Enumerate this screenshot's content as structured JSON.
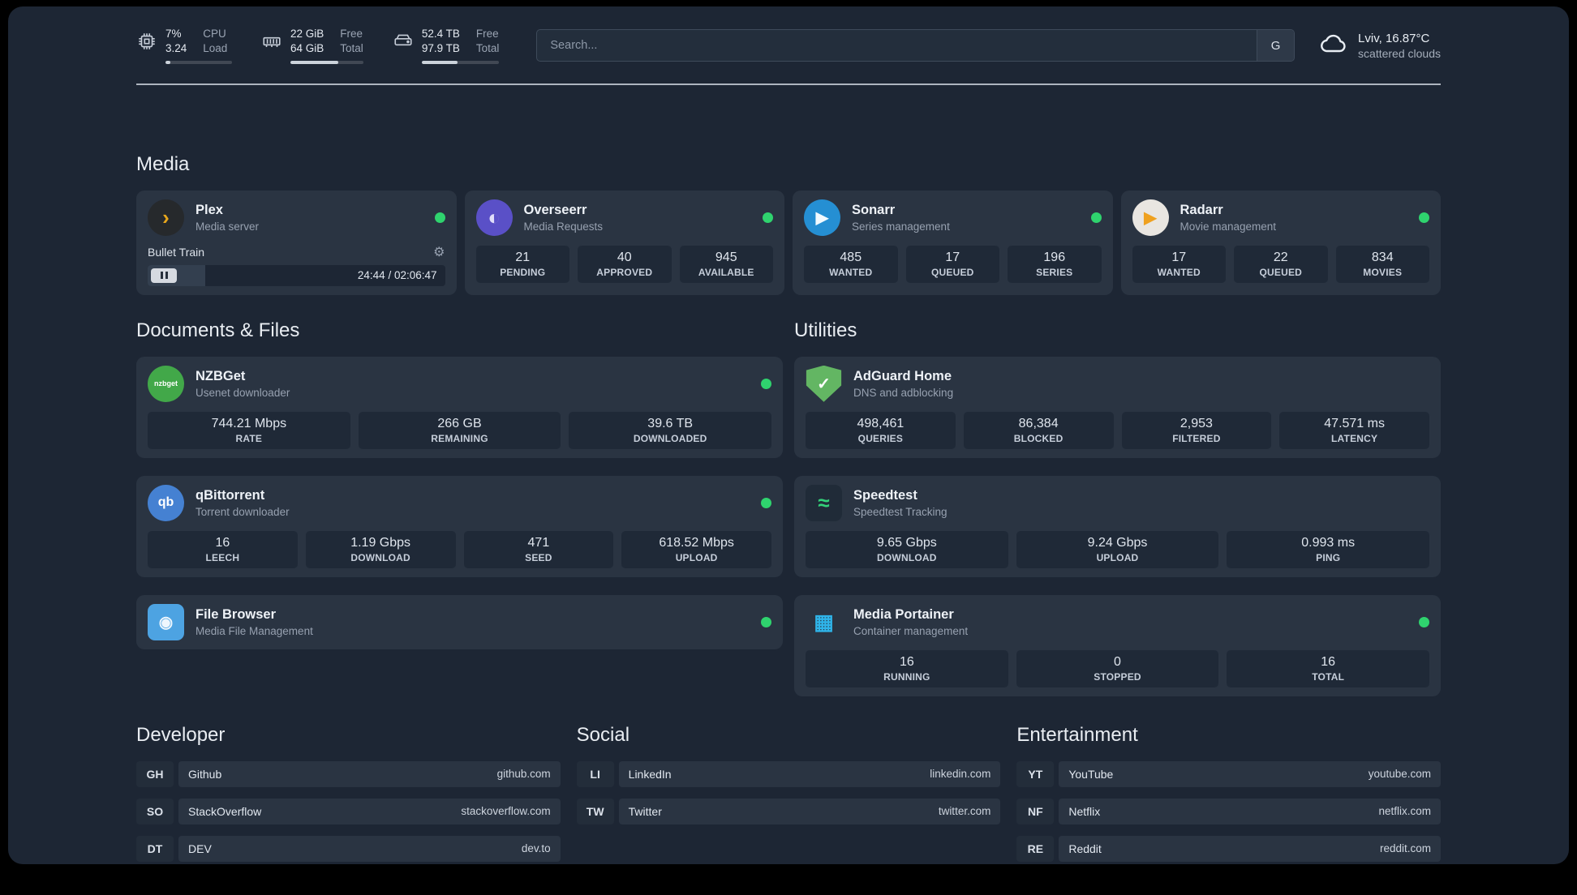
{
  "colors": {
    "status_online": "#2fd36e",
    "page_background": "#1d2634",
    "card_background": "#2a3442"
  },
  "icons": {
    "gear": "⚙"
  },
  "topbar": {
    "cpu": {
      "value": "7%",
      "load": "3.24",
      "label_top": "CPU",
      "label_bottom": "Load",
      "bar_percent": 7
    },
    "memory": {
      "free": "22 GiB",
      "total": "64 GiB",
      "label_top": "Free",
      "label_bottom": "Total",
      "bar_percent": 66
    },
    "storage": {
      "free": "52.4 TB",
      "total": "97.9 TB",
      "label_top": "Free",
      "label_bottom": "Total",
      "bar_percent": 46
    },
    "search": {
      "placeholder": "Search...",
      "button_label": "G"
    },
    "weather": {
      "location": "Lviv, 16.87°C",
      "condition": "scattered clouds"
    }
  },
  "sections": {
    "media": {
      "title": "Media",
      "cards": [
        {
          "name": "Plex",
          "subtitle": "Media server",
          "online": true,
          "icon": {
            "glyph": "›",
            "bg": "#26292c",
            "fg": "#e8a71c",
            "cls": "bigglyph"
          },
          "widget": {
            "title": "Bullet Train",
            "time": "24:44 / 02:06:47",
            "percent": 19.5
          },
          "stats": []
        },
        {
          "name": "Overseerr",
          "subtitle": "Media Requests",
          "online": true,
          "icon": {
            "glyph": "◐",
            "bg": "#5a50c7",
            "fg": "#e0defa",
            "cls": "bigglyph"
          },
          "stats": [
            {
              "value": "21",
              "label": "PENDING"
            },
            {
              "value": "40",
              "label": "APPROVED"
            },
            {
              "value": "945",
              "label": "AVAILABLE"
            }
          ]
        },
        {
          "name": "Sonarr",
          "subtitle": "Series management",
          "online": true,
          "icon": {
            "glyph": "▶",
            "bg": "#258fd3",
            "fg": "#f2faff"
          },
          "stats": [
            {
              "value": "485",
              "label": "WANTED"
            },
            {
              "value": "17",
              "label": "QUEUED"
            },
            {
              "value": "196",
              "label": "SERIES"
            }
          ]
        },
        {
          "name": "Radarr",
          "subtitle": "Movie management",
          "online": true,
          "icon": {
            "glyph": "▶",
            "bg": "#e9e6e1",
            "fg": "#efa11f"
          },
          "stats": [
            {
              "value": "17",
              "label": "WANTED"
            },
            {
              "value": "22",
              "label": "QUEUED"
            },
            {
              "value": "834",
              "label": "MOVIES"
            }
          ]
        }
      ]
    },
    "documents": {
      "title": "Documents & Files",
      "cards": [
        {
          "name": "NZBGet",
          "subtitle": "Usenet downloader",
          "online": true,
          "icon": {
            "glyph": "nzbget",
            "bg": "#42a849",
            "fg": "#ffffff",
            "cls": "tinytext"
          },
          "stats": [
            {
              "value": "744.21 Mbps",
              "label": "RATE"
            },
            {
              "value": "266 GB",
              "label": "REMAINING"
            },
            {
              "value": "39.6 TB",
              "label": "DOWNLOADED"
            }
          ]
        },
        {
          "name": "qBittorrent",
          "subtitle": "Torrent downloader",
          "online": true,
          "icon": {
            "glyph": "qb",
            "bg": "#4581d2",
            "fg": "#ffffff",
            "cls": "midtext"
          },
          "stats": [
            {
              "value": "16",
              "label": "LEECH"
            },
            {
              "value": "1.19 Gbps",
              "label": "DOWNLOAD"
            },
            {
              "value": "471",
              "label": "SEED"
            },
            {
              "value": "618.52 Mbps",
              "label": "UPLOAD"
            }
          ]
        },
        {
          "name": "File Browser",
          "subtitle": "Media File Management",
          "online": true,
          "icon": {
            "glyph": "◉",
            "bg": "#4da3e2",
            "fg": "#eef6fd",
            "cls": "rounded-sq"
          },
          "stats": []
        }
      ]
    },
    "utilities": {
      "title": "Utilities",
      "cards": [
        {
          "name": "AdGuard Home",
          "subtitle": "DNS and adblocking",
          "online": false,
          "icon": {
            "glyph": "✓",
            "bg": "#63b663",
            "fg": "#ffffff",
            "cls": "shield"
          },
          "stats": [
            {
              "value": "498,461",
              "label": "QUERIES"
            },
            {
              "value": "86,384",
              "label": "BLOCKED"
            },
            {
              "value": "2,953",
              "label": "FILTERED"
            },
            {
              "value": "47.571 ms",
              "label": "LATENCY"
            }
          ]
        },
        {
          "name": "Speedtest",
          "subtitle": "Speedtest Tracking",
          "online": false,
          "icon": {
            "glyph": "≈",
            "bg": "#202b38",
            "fg": "#33d17a",
            "cls": "rounded-sq bigglyph"
          },
          "stats": [
            {
              "value": "9.65 Gbps",
              "label": "DOWNLOAD"
            },
            {
              "value": "9.24 Gbps",
              "label": "UPLOAD"
            },
            {
              "value": "0.993 ms",
              "label": "PING"
            }
          ]
        },
        {
          "name": "Media Portainer",
          "subtitle": "Container management",
          "online": true,
          "icon": {
            "glyph": "▦",
            "bg": "transparent",
            "fg": "#2fb4e9",
            "cls": "bigglyph"
          },
          "stats": [
            {
              "value": "16",
              "label": "RUNNING"
            },
            {
              "value": "0",
              "label": "STOPPED"
            },
            {
              "value": "16",
              "label": "TOTAL"
            }
          ]
        }
      ]
    }
  },
  "bookmarks": {
    "groups": [
      {
        "title": "Developer",
        "items": [
          {
            "abbr": "GH",
            "name": "Github",
            "domain": "github.com"
          },
          {
            "abbr": "SO",
            "name": "StackOverflow",
            "domain": "stackoverflow.com"
          },
          {
            "abbr": "DT",
            "name": "DEV",
            "domain": "dev.to"
          }
        ]
      },
      {
        "title": "Social",
        "items": [
          {
            "abbr": "LI",
            "name": "LinkedIn",
            "domain": "linkedin.com"
          },
          {
            "abbr": "TW",
            "name": "Twitter",
            "domain": "twitter.com"
          }
        ]
      },
      {
        "title": "Entertainment",
        "items": [
          {
            "abbr": "YT",
            "name": "YouTube",
            "domain": "youtube.com"
          },
          {
            "abbr": "NF",
            "name": "Netflix",
            "domain": "netflix.com"
          },
          {
            "abbr": "RE",
            "name": "Reddit",
            "domain": "reddit.com"
          }
        ]
      }
    ]
  }
}
